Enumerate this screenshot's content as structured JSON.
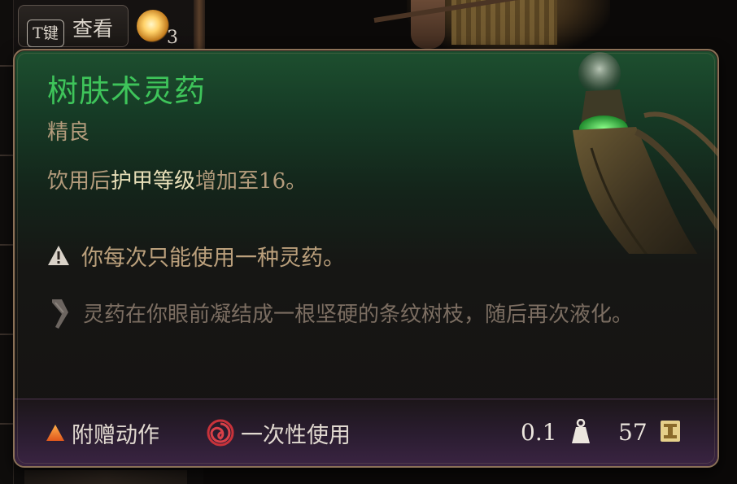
{
  "hint": {
    "key": "T键",
    "action": "查看",
    "count": "3"
  },
  "tooltip": {
    "name": "树肤术灵药",
    "rarity": "精良",
    "description": {
      "prefix": "饮用后",
      "highlight": "护甲等级",
      "suffix": "增加至16。"
    },
    "warning": "你每次只能使用一种灵药。",
    "flavor": "灵药在你眼前凝结成一根坚硬的条纹树枝，随后再次液化。"
  },
  "footer": {
    "action_type": "附赠动作",
    "usage": "一次性使用",
    "weight": "0.1",
    "value": "57"
  },
  "colors": {
    "name_green": "#3ec45a",
    "rarity_tan": "#b49c7c",
    "highlight": "#e8dfb8",
    "flavor_gray": "#7c6e62",
    "border": "#8b7157",
    "footer_purple": "#3a2442"
  },
  "icons": [
    "key-cap",
    "elixir-icon",
    "warning-icon",
    "quill-icon",
    "triangle-icon",
    "swirl-icon",
    "weight-icon",
    "gold-icon"
  ]
}
